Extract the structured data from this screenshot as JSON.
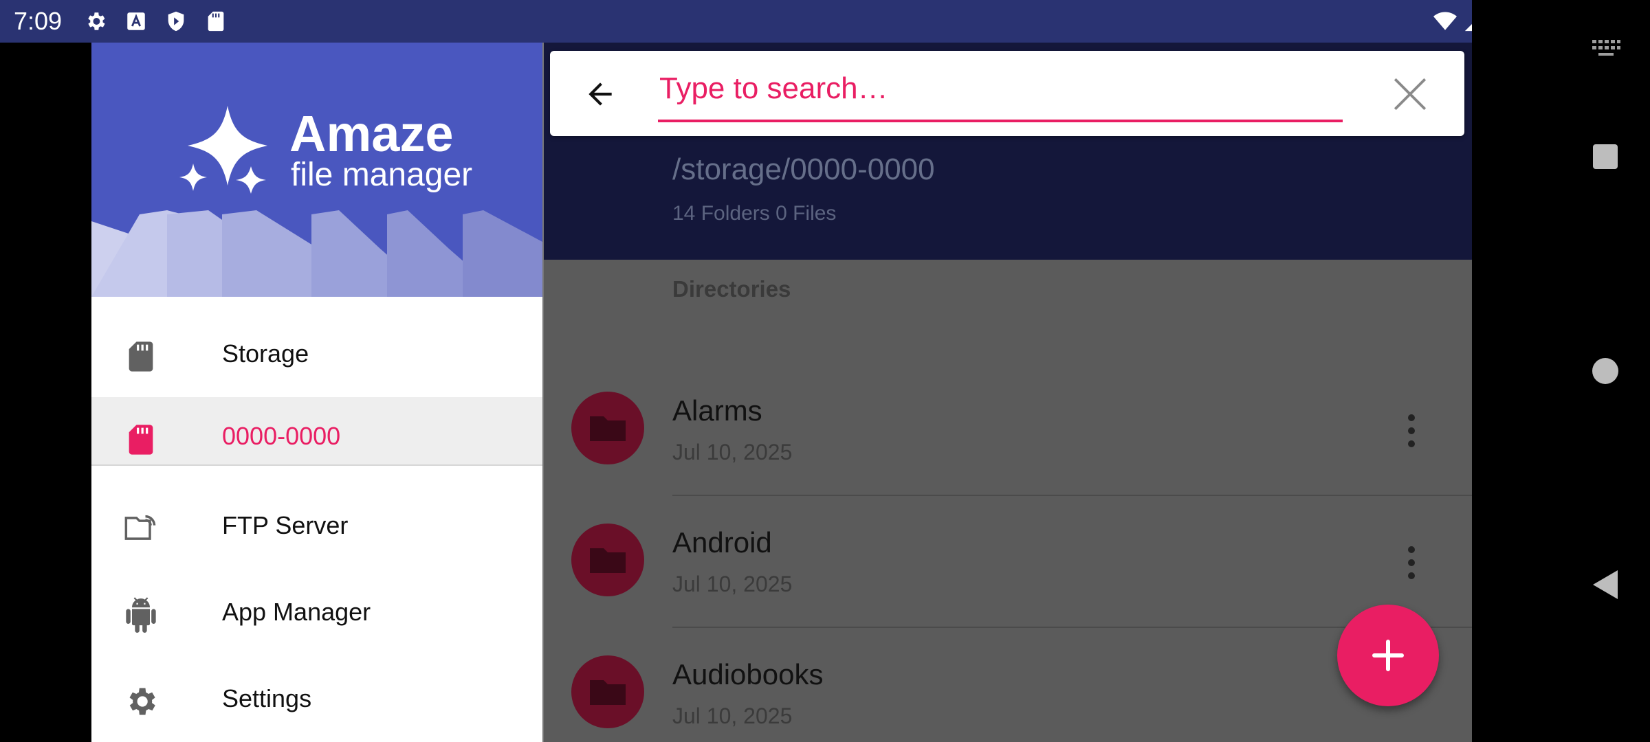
{
  "status_bar": {
    "time": "7:09"
  },
  "drawer": {
    "logo_title": "Amaze",
    "logo_subtitle": "file manager",
    "items": [
      {
        "label": "Storage",
        "icon": "sd-card-icon"
      },
      {
        "label": "0000-0000",
        "icon": "sd-card-icon",
        "active": true
      },
      {
        "label": "FTP Server",
        "icon": "ftp-folder-icon"
      },
      {
        "label": "App Manager",
        "icon": "android-icon"
      },
      {
        "label": "Settings",
        "icon": "gear-icon"
      }
    ]
  },
  "search": {
    "placeholder": "Type to search…",
    "value": ""
  },
  "main": {
    "path": "/storage/0000-0000",
    "counts": "14 Folders 0 Files",
    "section_title": "Directories",
    "folders": [
      {
        "name": "Alarms",
        "date": "Jul 10, 2025"
      },
      {
        "name": "Android",
        "date": "Jul 10, 2025"
      },
      {
        "name": "Audiobooks",
        "date": "Jul 10, 2025"
      }
    ]
  },
  "colors": {
    "accent": "#e91e63",
    "primary": "#4a57bf",
    "status_bar": "#2a3372"
  },
  "fab": {
    "icon": "plus-icon"
  }
}
